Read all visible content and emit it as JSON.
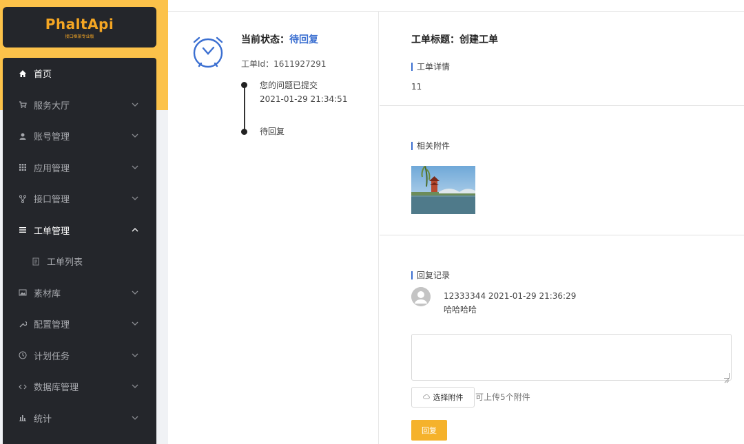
{
  "app": {
    "logo_text": "PhaltApi",
    "logo_sub": "接口框架专业版"
  },
  "sidebar": {
    "items": [
      {
        "label": "首页",
        "icon": "home-icon"
      },
      {
        "label": "服务大厅",
        "icon": "cart-icon"
      },
      {
        "label": "账号管理",
        "icon": "user-icon"
      },
      {
        "label": "应用管理",
        "icon": "grid-icon"
      },
      {
        "label": "接口管理",
        "icon": "branch-icon"
      },
      {
        "label": "工单管理",
        "icon": "list-icon"
      },
      {
        "label": "工单列表",
        "icon": "document-icon"
      },
      {
        "label": "素材库",
        "icon": "image-icon"
      },
      {
        "label": "配置管理",
        "icon": "wrench-icon"
      },
      {
        "label": "计划任务",
        "icon": "clock-icon"
      },
      {
        "label": "数据库管理",
        "icon": "code-icon"
      },
      {
        "label": "统计",
        "icon": "bar-chart-icon"
      }
    ]
  },
  "ticket": {
    "status_label": "当前状态：",
    "status_value": "待回复",
    "id_label": "工单Id：",
    "id_value": "1611927291",
    "timeline": [
      {
        "text": "您的问题已提交",
        "time": "2021-01-29 21:34:51"
      },
      {
        "text": "待回复",
        "time": ""
      }
    ],
    "title_label": "工单标题：",
    "title_value": "创建工单",
    "detail_heading": "工单详情",
    "detail_value": "11",
    "attachments_heading": "相关附件",
    "replies_heading": "回复记录",
    "replies": [
      {
        "user": "12333344",
        "time": "2021-01-29 21:36:29",
        "content": "哈哈哈哈"
      }
    ],
    "reply_placeholder": "",
    "attach_button": "选择附件",
    "attach_hint": "可上传5个附件",
    "reply_button": "回复"
  },
  "colors": {
    "accent": "#f5b22b",
    "sidebar_bg": "#24262b",
    "status_blue": "#3b6fd1"
  }
}
